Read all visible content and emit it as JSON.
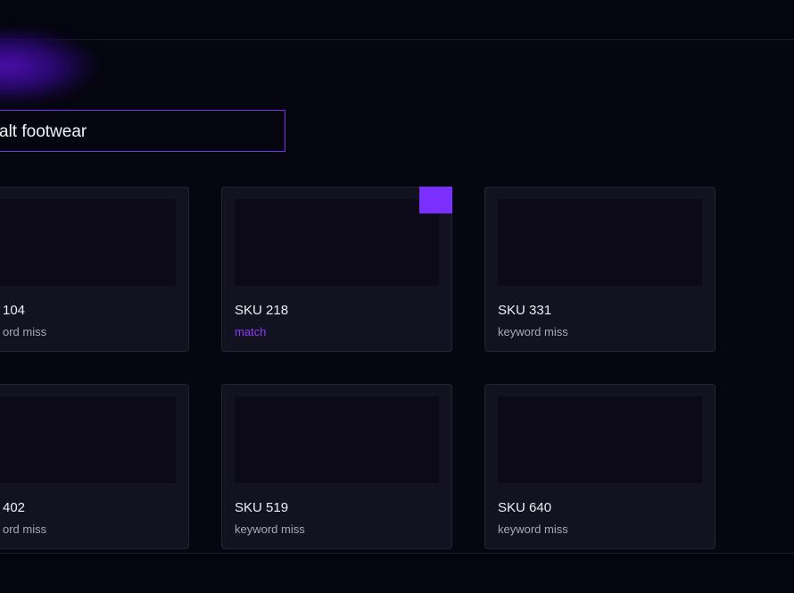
{
  "search": {
    "value": "alt footwear"
  },
  "accent_color": "#7b2fff",
  "cards": [
    {
      "sku": "104",
      "status": "keyword miss",
      "is_match": false
    },
    {
      "sku": "SKU 218",
      "status": "match",
      "is_match": true
    },
    {
      "sku": "SKU 331",
      "status": "keyword miss",
      "is_match": false
    },
    {
      "sku": "402",
      "status": "keyword miss",
      "is_match": false
    },
    {
      "sku": "SKU 519",
      "status": "keyword miss",
      "is_match": false
    },
    {
      "sku": "SKU 640",
      "status": "keyword miss",
      "is_match": false
    }
  ],
  "cards_visible_text": {
    "card_0_sku": "104",
    "card_0_status": "ord miss",
    "card_3_sku": "402",
    "card_3_status": "ord miss"
  }
}
